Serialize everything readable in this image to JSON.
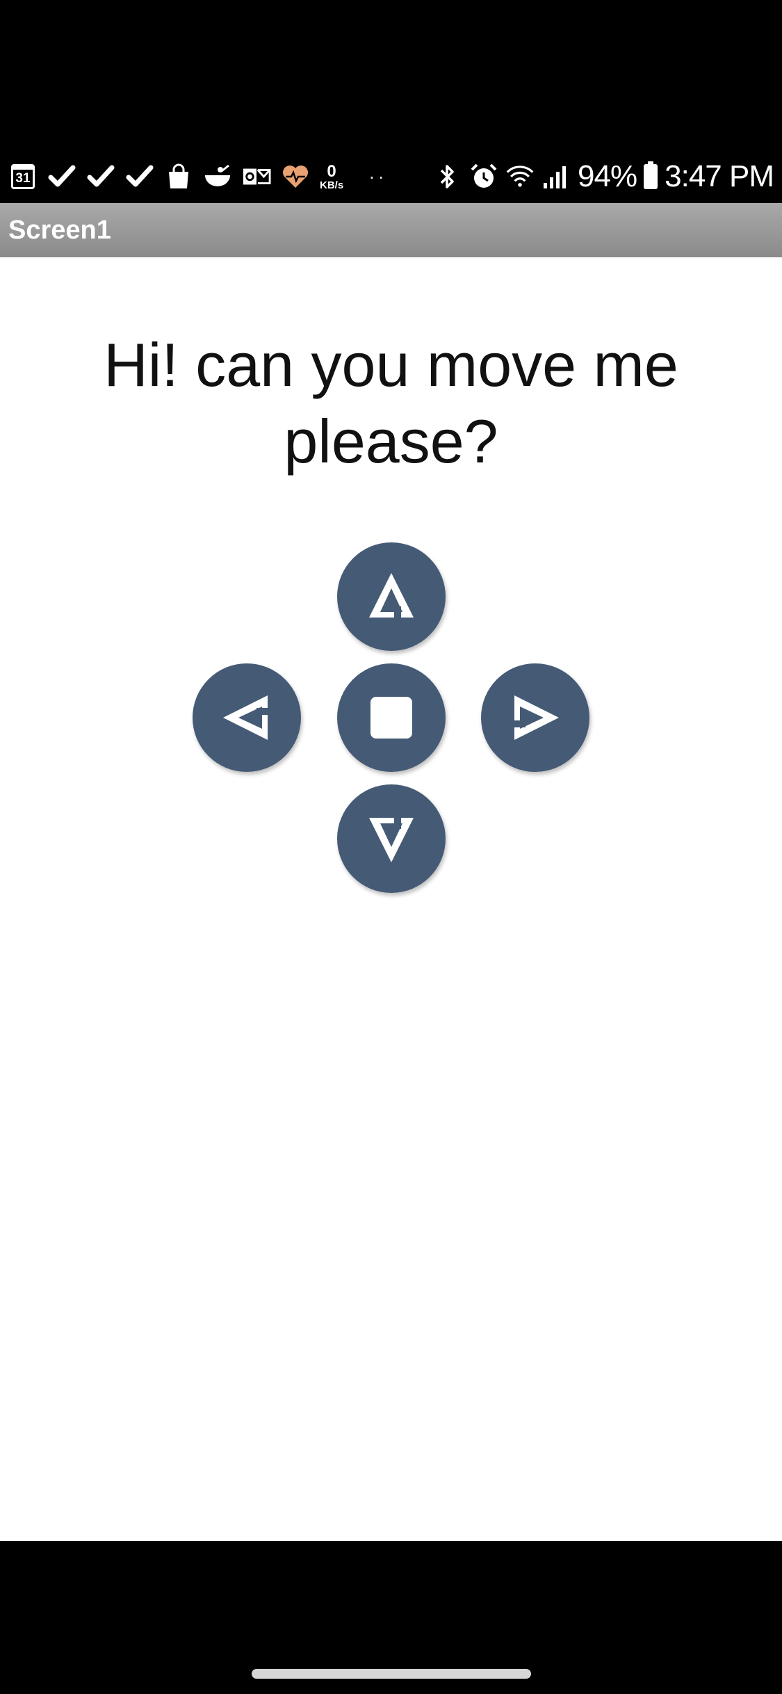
{
  "status_bar": {
    "calendar_day": "31",
    "network_speed_value": "0",
    "network_speed_unit": "KB/s",
    "more_dots": "··",
    "battery_percent": "94%",
    "time": "3:47 PM"
  },
  "title_bar": {
    "title": "Screen1"
  },
  "main": {
    "prompt": "Hi! can you move me please?"
  },
  "dpad": {
    "button_color": "#455a75",
    "icon_color": "#ffffff",
    "buttons": [
      "up",
      "left",
      "stop",
      "right",
      "down"
    ]
  }
}
